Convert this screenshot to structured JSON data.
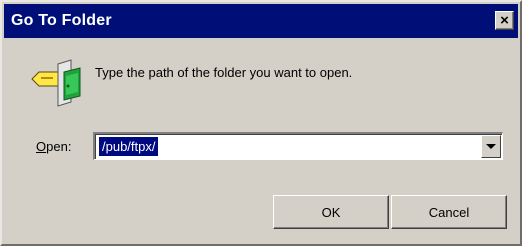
{
  "window": {
    "title": "Go To Folder",
    "close_glyph": "×"
  },
  "icons": {
    "folder": "folder-go-icon",
    "dropdown": "chevron-down-icon",
    "close": "close-icon"
  },
  "prompt": {
    "text": "Type the path of the folder you want to open."
  },
  "open_field": {
    "label_underlined": "O",
    "label_rest": "pen:",
    "value": "/pub/ftpx/"
  },
  "buttons": {
    "ok": "OK",
    "cancel": "Cancel"
  },
  "colors": {
    "titlebar": "#000f78",
    "selection": "#000a80",
    "dialog_bg": "#d4d0c8"
  }
}
